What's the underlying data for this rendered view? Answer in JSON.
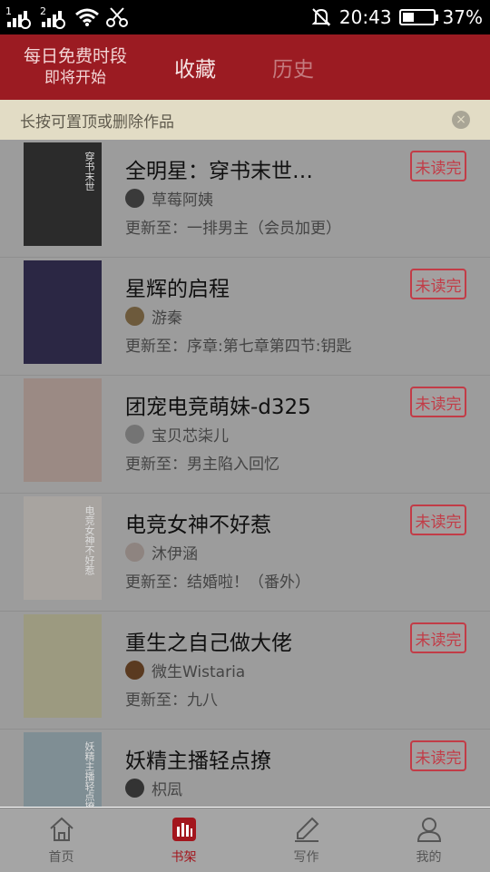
{
  "status_bar": {
    "sim1": "1",
    "sim2": "2",
    "time": "20:43",
    "battery": "37%",
    "battery_level": 0.37
  },
  "header": {
    "promo_line1": "每日免费时段",
    "promo_line2": "即将开始",
    "tab_favorites": "收藏",
    "tab_history": "历史"
  },
  "tip": {
    "text": "长按可置顶或删除作品",
    "close_icon": "×"
  },
  "books": [
    {
      "title": "全明星：穿书末世…",
      "author": "草莓阿姨",
      "update": "更新至：一排男主（会员加更）",
      "status": "未读完",
      "cover_text": "穿书末世",
      "cover_color": "#2b2b2b",
      "avatar_color": "#3a3a3a"
    },
    {
      "title": "星辉的启程",
      "author": "游秦",
      "update": "更新至：序章:第七章第四节:钥匙",
      "status": "未读完",
      "cover_text": "",
      "cover_color": "#2b2744",
      "avatar_color": "#6d5a3c"
    },
    {
      "title": "团宠电竞萌妹-d325",
      "author": "宝贝芯柒儿",
      "update": "更新至：男主陷入回忆",
      "status": "未读完",
      "cover_text": "",
      "cover_color": "#9b8a84",
      "avatar_color": "#747474"
    },
    {
      "title": "电竞女神不好惹",
      "author": "沐伊涵",
      "update": "更新至：结婚啦！（番外）",
      "status": "未读完",
      "cover_text": "电竞女神不好惹",
      "cover_color": "#a8a4a0",
      "avatar_color": "#8e8480"
    },
    {
      "title": "重生之自己做大佬",
      "author": "微生Wistaria",
      "update": "更新至：九八",
      "status": "未读完",
      "cover_text": "",
      "cover_color": "#9c9a80",
      "avatar_color": "#5a3a20"
    },
    {
      "title": "妖精主播轻点撩",
      "author": "枳凨",
      "update": "",
      "status": "未读完",
      "cover_text": "妖精主播轻点撩",
      "cover_color": "#7f8e94",
      "avatar_color": "#333"
    }
  ],
  "bottom_nav": [
    {
      "label": "首页",
      "icon": "home-icon"
    },
    {
      "label": "书架",
      "icon": "bookshelf-icon"
    },
    {
      "label": "写作",
      "icon": "pen-icon"
    },
    {
      "label": "我的",
      "icon": "person-icon"
    }
  ],
  "colors": {
    "header_bg": "#9b1b22",
    "accent": "#a3161d",
    "badge": "#c23c47"
  }
}
